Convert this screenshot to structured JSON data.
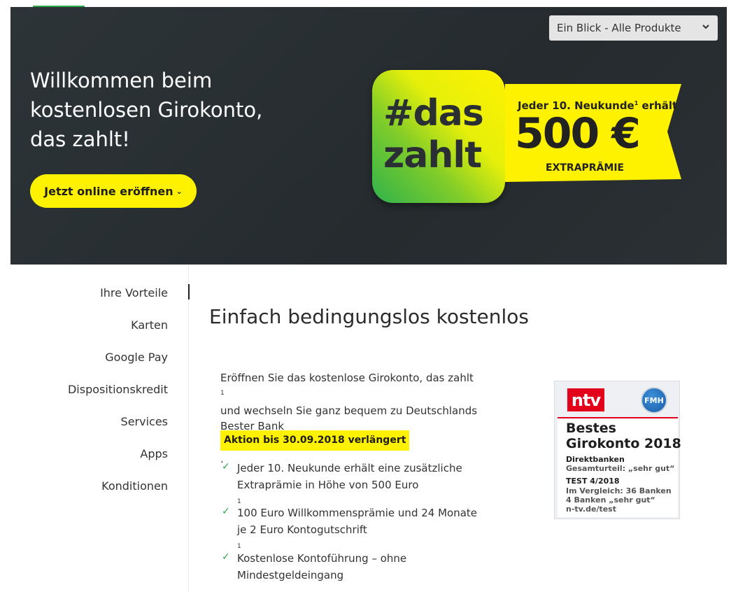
{
  "hero": {
    "title_lines": [
      "Willkommen beim",
      "kostenlosen Girokonto,",
      "das zahlt!"
    ],
    "cta_label": "Jetzt online eröffnen",
    "cta_chevron": "⌄",
    "product_select": "Ein Blick - Alle Produkte",
    "badge": {
      "line1": "#das",
      "line2": "zahlt"
    },
    "ribbon": {
      "line1_text": "Jeder 10. Neukunde",
      "line1_sup": "1",
      "line1_end": " erhält",
      "amount": "500 €",
      "label": "EXTRAPRÄMIE"
    }
  },
  "sidenav": {
    "items": [
      {
        "label": "Ihre Vorteile",
        "active": true
      },
      {
        "label": "Karten"
      },
      {
        "label": "Google Pay"
      },
      {
        "label": "Dispositionskredit"
      },
      {
        "label": "Services"
      },
      {
        "label": "Apps"
      },
      {
        "label": "Konditionen"
      }
    ]
  },
  "main": {
    "heading": "Einfach bedingungslos kostenlos",
    "intro": {
      "line1": "Eröffnen Sie das kostenlose Girokonto, das zahlt",
      "line1_sup": "1",
      "line2": "und wechseln Sie ganz bequem zu Deutschlands",
      "line3": "Bester Bank",
      "line3_sup": "2",
      "line3_end": "."
    },
    "promo_highlight": "Aktion bis 30.09.2018 verlängert",
    "bullets": [
      {
        "line1": "Jeder 10. Neukunde erhält eine zusätzliche",
        "line2": "Extraprämie in Höhe von 500 Euro",
        "sup": "1"
      },
      {
        "line1": "100 Euro Willkommensprämie und 24 Monate",
        "line2": "je 2 Euro Kontogutschrift",
        "sup": "1"
      },
      {
        "line1": "Kostenlose Kontoführung – ohne",
        "line2": "Mindestgeldeingang",
        "sup": ""
      }
    ],
    "seal": {
      "ntv": "ntv",
      "fmh": "FMH",
      "title1": "Bestes",
      "title2": "Girokonto 2018",
      "category": "Direktbanken",
      "rating": "Gesamturteil: „sehr gut“",
      "test": "TEST 4/2018",
      "compare1": "Im Vergleich: 36 Banken",
      "compare2": "4 Banken „sehr gut“",
      "url": "n-tv.de/test"
    }
  },
  "colors": {
    "brand_yellow": "#fff200",
    "brand_green": "#2ea84a",
    "hero_bg": "#2a3033",
    "ntv_red": "#e2001a"
  }
}
